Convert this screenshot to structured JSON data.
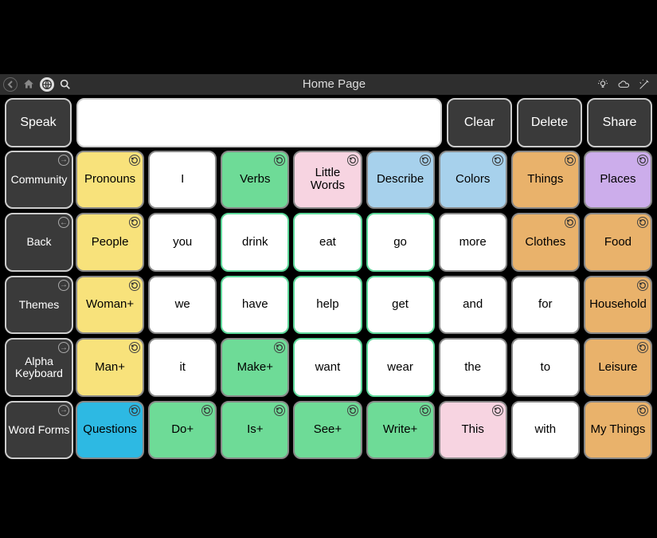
{
  "titlebar": {
    "title": "Home Page"
  },
  "top": {
    "speak": "Speak",
    "clear": "Clear",
    "delete": "Delete",
    "share": "Share"
  },
  "nav": [
    {
      "label": "Community",
      "arrow": "→"
    },
    {
      "label": "Back",
      "arrow": "←"
    },
    {
      "label": "Themes",
      "arrow": "→"
    },
    {
      "label": "Alpha Keyboard",
      "arrow": "→"
    },
    {
      "label": "Word Forms",
      "arrow": "→"
    }
  ],
  "cells": [
    [
      {
        "label": "Pronouns",
        "color": "c-yellow",
        "corner": true
      },
      {
        "label": "I",
        "color": "c-white"
      },
      {
        "label": "Verbs",
        "color": "c-green",
        "corner": true
      },
      {
        "label": "Little Words",
        "color": "c-pink",
        "corner": true
      },
      {
        "label": "Describe",
        "color": "c-bluel",
        "corner": true
      },
      {
        "label": "Colors",
        "color": "c-bluel",
        "corner": true
      },
      {
        "label": "Things",
        "color": "c-orange",
        "corner": true
      },
      {
        "label": "Places",
        "color": "c-purple",
        "corner": true
      }
    ],
    [
      {
        "label": "People",
        "color": "c-yellow",
        "corner": true
      },
      {
        "label": "you",
        "color": "c-white"
      },
      {
        "label": "drink",
        "color": "c-whiteg"
      },
      {
        "label": "eat",
        "color": "c-whiteg"
      },
      {
        "label": "go",
        "color": "c-whiteg"
      },
      {
        "label": "more",
        "color": "c-white"
      },
      {
        "label": "Clothes",
        "color": "c-orange",
        "corner": true
      },
      {
        "label": "Food",
        "color": "c-orange",
        "corner": true
      }
    ],
    [
      {
        "label": "Woman+",
        "color": "c-yellow",
        "corner": true
      },
      {
        "label": "we",
        "color": "c-white"
      },
      {
        "label": "have",
        "color": "c-whiteg"
      },
      {
        "label": "help",
        "color": "c-whiteg"
      },
      {
        "label": "get",
        "color": "c-whiteg"
      },
      {
        "label": "and",
        "color": "c-white"
      },
      {
        "label": "for",
        "color": "c-white"
      },
      {
        "label": "Household",
        "color": "c-orange",
        "corner": true
      }
    ],
    [
      {
        "label": "Man+",
        "color": "c-yellow",
        "corner": true
      },
      {
        "label": "it",
        "color": "c-white"
      },
      {
        "label": "Make+",
        "color": "c-green",
        "corner": true
      },
      {
        "label": "want",
        "color": "c-whiteg"
      },
      {
        "label": "wear",
        "color": "c-whiteg"
      },
      {
        "label": "the",
        "color": "c-white"
      },
      {
        "label": "to",
        "color": "c-white"
      },
      {
        "label": "Leisure",
        "color": "c-orange",
        "corner": true
      }
    ],
    [
      {
        "label": "Questions",
        "color": "c-blue",
        "corner": true
      },
      {
        "label": "Do+",
        "color": "c-green",
        "corner": true
      },
      {
        "label": "Is+",
        "color": "c-green",
        "corner": true
      },
      {
        "label": "See+",
        "color": "c-green",
        "corner": true
      },
      {
        "label": "Write+",
        "color": "c-green",
        "corner": true
      },
      {
        "label": "This",
        "color": "c-pink",
        "corner": true
      },
      {
        "label": "with",
        "color": "c-white"
      },
      {
        "label": "My Things",
        "color": "c-orange",
        "corner": true
      }
    ]
  ]
}
